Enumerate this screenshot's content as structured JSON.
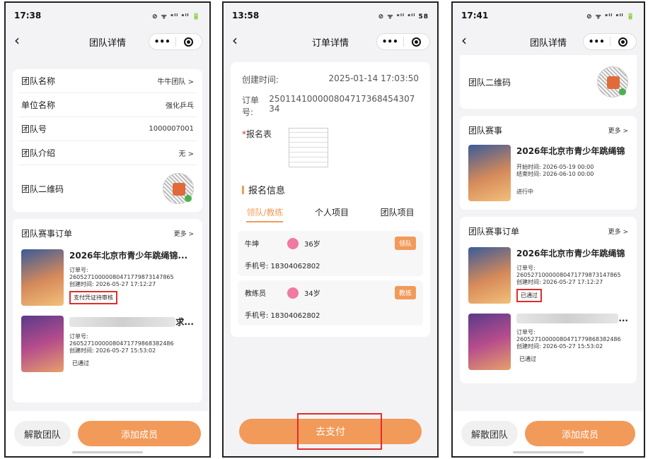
{
  "p1": {
    "time": "17:38",
    "status_icons": "⊘ ᯤ ᵉˡˡ ᵉˡˡ 🔋",
    "title": "团队详情",
    "info": [
      {
        "label": "团队名称",
        "value": "牛牛团队 >"
      },
      {
        "label": "单位名称",
        "value": "强化乒乓"
      },
      {
        "label": "团队号",
        "value": "1000007001"
      },
      {
        "label": "团队介绍",
        "value": "无 >"
      }
    ],
    "qr_label": "团队二维码",
    "orders_title": "团队赛事订单",
    "more": "更多 >",
    "order1": {
      "title": "2026年北京市青少年跳绳锦...",
      "no_label": "订单号:",
      "no": "2605271000008047177987314786​5",
      "created": "创建时间: 2026-05-27 17:12:27",
      "status": "支付凭证待审核"
    },
    "order2": {
      "title_tail": "求...",
      "no_label": "订单号:",
      "no": "2605271000008047177986838248​6",
      "created": "创建时间: 2026-05-27 15:53:02",
      "status": "已通过"
    },
    "btn_dissolve": "解散团队",
    "btn_add": "添加成员"
  },
  "p2": {
    "time": "13:58",
    "status_icons": "⊘ ᯤ ᵉˡˡ ᵉˡˡ 58",
    "title": "订单详情",
    "created_label": "创建时间:",
    "created_value": "2025-01-14 17:03:50",
    "no_label": "订单号:",
    "no_value": "250114100000804717368454307​34",
    "form_label": "报名表",
    "form_req": "*",
    "section": "报名信息",
    "tabs": [
      "领队/教练",
      "个人项目",
      "团队项目"
    ],
    "persons": [
      {
        "name": "牛坤",
        "age": "36岁",
        "role": "领队",
        "phone": "手机号: 18304062802"
      },
      {
        "name": "教练员",
        "age": "34岁",
        "role": "教练",
        "phone": "手机号: 18304062802"
      }
    ],
    "pay": "去支付"
  },
  "p3": {
    "time": "17:41",
    "status_icons": "⊘ ᯤ ᵉˡˡ ᵉˡˡ 🔋",
    "title": "团队详情",
    "qr_label": "团队二维码",
    "events_title": "团队赛事",
    "more": "更多 >",
    "event": {
      "title": "2026年北京市青少年跳绳锦 ...",
      "start": "开始时间: 2026-05-19 00:00",
      "end": "结束时间: 2026-06-10 00:00",
      "status": "进行中"
    },
    "orders_title": "团队赛事订单",
    "order1": {
      "title": "2026年北京市青少年跳绳锦 ...",
      "no_label": "订单号:",
      "no": "2605271000008047177987314786​5",
      "created": "创建时间: 2026-05-27 17:12:27",
      "status": "已通过"
    },
    "order2": {
      "title_tail": "...",
      "no_label": "订单号:",
      "no": "2605271000008047177986838248​6",
      "created": "创建时间: 2026-05-27 15:53:02",
      "status": "已通过"
    },
    "btn_dissolve": "解散团队",
    "btn_add": "添加成员"
  }
}
